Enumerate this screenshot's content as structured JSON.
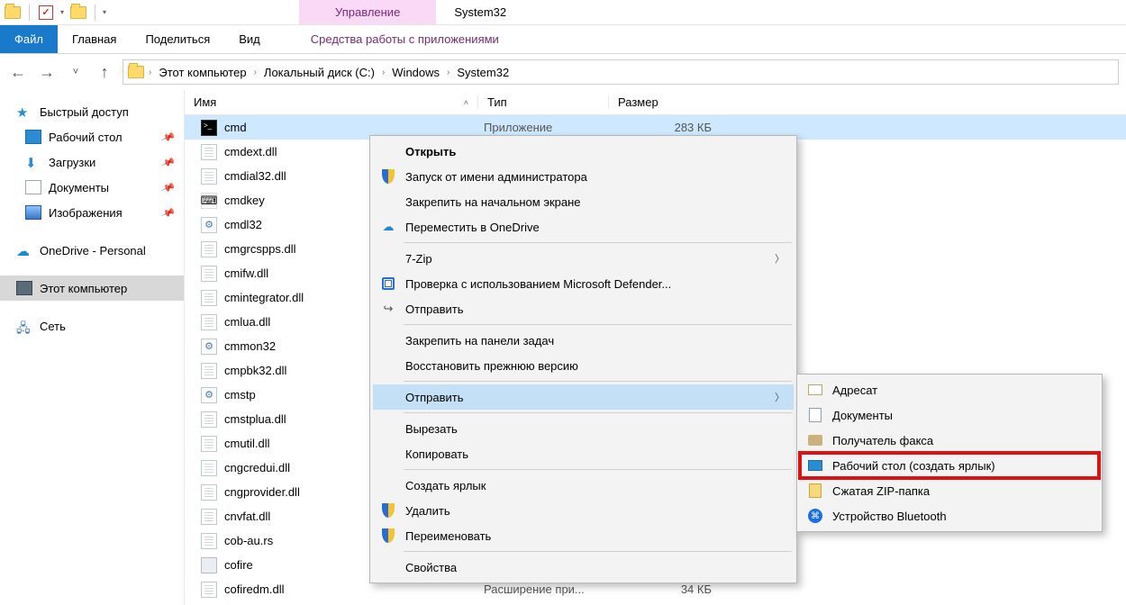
{
  "title_tab": "Управление",
  "window_title": "System32",
  "ribbon": {
    "file": "Файл",
    "home": "Главная",
    "share": "Поделиться",
    "view": "Вид",
    "tools": "Средства работы с приложениями"
  },
  "breadcrumbs": [
    "Этот компьютер",
    "Локальный диск (C:)",
    "Windows",
    "System32"
  ],
  "columns": {
    "name": "Имя",
    "type": "Тип",
    "size": "Размер"
  },
  "sidebar": {
    "quick": "Быстрый доступ",
    "desktop": "Рабочий стол",
    "downloads": "Загрузки",
    "documents": "Документы",
    "pictures": "Изображения",
    "onedrive": "OneDrive - Personal",
    "thispc": "Этот компьютер",
    "network": "Сеть"
  },
  "files": [
    {
      "name": "cmd",
      "type": "Приложение",
      "size": "283 КБ",
      "icon": "cmd",
      "sel": true
    },
    {
      "name": "cmdext.dll",
      "icon": "dll"
    },
    {
      "name": "cmdial32.dll",
      "icon": "dll"
    },
    {
      "name": "cmdkey",
      "icon": "key"
    },
    {
      "name": "cmdl32",
      "icon": "gear"
    },
    {
      "name": "cmgrcspps.dll",
      "icon": "dll"
    },
    {
      "name": "cmifw.dll",
      "icon": "dll"
    },
    {
      "name": "cmintegrator.dll",
      "icon": "dll"
    },
    {
      "name": "cmlua.dll",
      "icon": "dll"
    },
    {
      "name": "cmmon32",
      "icon": "gear"
    },
    {
      "name": "cmpbk32.dll",
      "icon": "dll"
    },
    {
      "name": "cmstp",
      "icon": "gear"
    },
    {
      "name": "cmstplua.dll",
      "icon": "dll"
    },
    {
      "name": "cmutil.dll",
      "icon": "dll"
    },
    {
      "name": "cngcredui.dll",
      "icon": "dll"
    },
    {
      "name": "cngprovider.dll",
      "icon": "dll"
    },
    {
      "name": "cnvfat.dll",
      "icon": "dll"
    },
    {
      "name": "cob-au.rs",
      "icon": "file"
    },
    {
      "name": "cofire",
      "icon": "app"
    },
    {
      "name": "cofiredm.dll",
      "type": "Расширение при...",
      "size": "34 КБ",
      "icon": "dll"
    }
  ],
  "context": {
    "open": "Открыть",
    "runas": "Запуск от имени администратора",
    "pin_start": "Закрепить на начальном экране",
    "onedrive": "Переместить в OneDrive",
    "sevenzip": "7-Zip",
    "defender": "Проверка с использованием Microsoft Defender...",
    "share": "Отправить",
    "pin_task": "Закрепить на панели задач",
    "restore": "Восстановить прежнюю версию",
    "sendto": "Отправить",
    "cut": "Вырезать",
    "copy": "Копировать",
    "shortcut": "Создать ярлык",
    "delete": "Удалить",
    "rename": "Переименовать",
    "props": "Свойства"
  },
  "sendto": {
    "mail": "Адресат",
    "docs": "Документы",
    "fax": "Получатель факса",
    "desktop": "Рабочий стол (создать ярлык)",
    "zip": "Сжатая ZIP-папка",
    "bt": "Устройство Bluetooth"
  }
}
